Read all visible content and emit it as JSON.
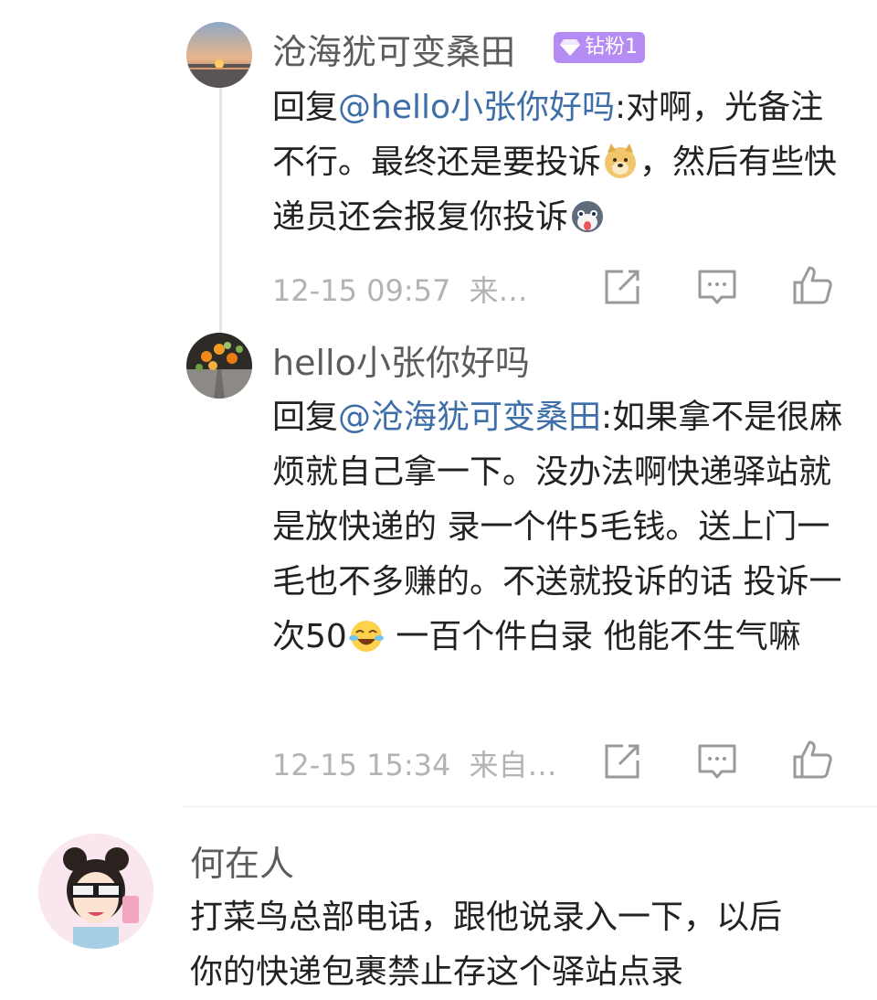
{
  "comments": [
    {
      "user": "沧海犹可变桑田",
      "badge": "钻粉1",
      "reply_prefix": "回复",
      "mention": "@hello小张你好吗",
      "text_1": ":对啊，光备注不行。最终还是要投诉",
      "text_2": "，然后有些快递员还会报复你投诉",
      "time": "12-15 09:57",
      "source": "来…"
    },
    {
      "user": "hello小张你好吗",
      "reply_prefix": "回复",
      "mention": "@沧海犹可变桑田",
      "text_1": ":如果拿不是很麻烦就自己拿一下。没办法啊快递驿站就是放快递的 录一个件5毛钱。送上门一毛也不多赚的。不送就投诉的话 投诉一次50",
      "text_2": " 一百个件白录 他能不生气嘛",
      "time": "12-15 15:34",
      "source": "来自…"
    },
    {
      "user": "何在人",
      "text": "打菜鸟总部电话，跟他说录入一下，以后你的快递包裹禁止存这个驿站点录"
    }
  ],
  "icons": [
    "share-icon",
    "comment-icon",
    "like-icon",
    "doge-emoji",
    "husky-emoji",
    "laugh-cry-emoji",
    "diamond-icon"
  ],
  "colors": {
    "mention": "#3d6ea8",
    "badge": "#b58cf4",
    "meta": "#b3b3b3"
  }
}
